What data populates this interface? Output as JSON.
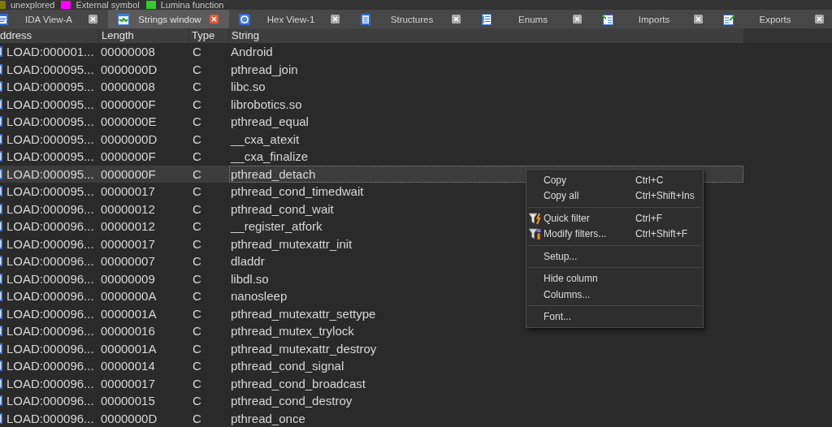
{
  "legend": [
    {
      "label": "unexplored",
      "color": "#807a00"
    },
    {
      "label": "External symbol",
      "color": "#ff00ff"
    },
    {
      "label": "Lumina function",
      "color": "#33cc33"
    }
  ],
  "tabs": [
    {
      "label": "IDA View-A",
      "kind": "ida-view",
      "selected": false
    },
    {
      "label": "Strings window",
      "kind": "strings",
      "selected": true
    },
    {
      "label": "Hex View-1",
      "kind": "hex",
      "selected": false
    },
    {
      "label": "Structures",
      "kind": "structures",
      "selected": false
    },
    {
      "label": "Enums",
      "kind": "enums",
      "selected": false
    },
    {
      "label": "Imports",
      "kind": "imports",
      "selected": false
    },
    {
      "label": "Exports",
      "kind": "exports",
      "selected": false
    }
  ],
  "table": {
    "columns": [
      "ddress",
      "Length",
      "Type",
      "String"
    ],
    "rows": [
      {
        "address": "LOAD:000001...",
        "length": "00000008",
        "type": "C",
        "string": "Android",
        "selected": false
      },
      {
        "address": "LOAD:000095...",
        "length": "0000000D",
        "type": "C",
        "string": "pthread_join",
        "selected": false
      },
      {
        "address": "LOAD:000095...",
        "length": "00000008",
        "type": "C",
        "string": "libc.so",
        "selected": false
      },
      {
        "address": "LOAD:000095...",
        "length": "0000000F",
        "type": "C",
        "string": "librobotics.so",
        "selected": false
      },
      {
        "address": "LOAD:000095...",
        "length": "0000000E",
        "type": "C",
        "string": "pthread_equal",
        "selected": false
      },
      {
        "address": "LOAD:000095...",
        "length": "0000000D",
        "type": "C",
        "string": "__cxa_atexit",
        "selected": false
      },
      {
        "address": "LOAD:000095...",
        "length": "0000000F",
        "type": "C",
        "string": "__cxa_finalize",
        "selected": false
      },
      {
        "address": "LOAD:000095...",
        "length": "0000000F",
        "type": "C",
        "string": "pthread_detach",
        "selected": true
      },
      {
        "address": "LOAD:000095...",
        "length": "00000017",
        "type": "C",
        "string": "pthread_cond_timedwait",
        "selected": false
      },
      {
        "address": "LOAD:000096...",
        "length": "00000012",
        "type": "C",
        "string": "pthread_cond_wait",
        "selected": false
      },
      {
        "address": "LOAD:000096...",
        "length": "00000012",
        "type": "C",
        "string": "__register_atfork",
        "selected": false
      },
      {
        "address": "LOAD:000096...",
        "length": "00000017",
        "type": "C",
        "string": "pthread_mutexattr_init",
        "selected": false
      },
      {
        "address": "LOAD:000096...",
        "length": "00000007",
        "type": "C",
        "string": "dladdr",
        "selected": false
      },
      {
        "address": "LOAD:000096...",
        "length": "00000009",
        "type": "C",
        "string": "libdl.so",
        "selected": false
      },
      {
        "address": "LOAD:000096...",
        "length": "0000000A",
        "type": "C",
        "string": "nanosleep",
        "selected": false
      },
      {
        "address": "LOAD:000096...",
        "length": "0000001A",
        "type": "C",
        "string": "pthread_mutexattr_settype",
        "selected": false
      },
      {
        "address": "LOAD:000096...",
        "length": "00000016",
        "type": "C",
        "string": "pthread_mutex_trylock",
        "selected": false
      },
      {
        "address": "LOAD:000096...",
        "length": "0000001A",
        "type": "C",
        "string": "pthread_mutexattr_destroy",
        "selected": false
      },
      {
        "address": "LOAD:000096...",
        "length": "00000014",
        "type": "C",
        "string": "pthread_cond_signal",
        "selected": false
      },
      {
        "address": "LOAD:000096...",
        "length": "00000017",
        "type": "C",
        "string": "pthread_cond_broadcast",
        "selected": false
      },
      {
        "address": "LOAD:000096...",
        "length": "00000015",
        "type": "C",
        "string": "pthread_cond_destroy",
        "selected": false
      },
      {
        "address": "LOAD:000096...",
        "length": "0000000D",
        "type": "C",
        "string": "pthread_once",
        "selected": false
      }
    ]
  },
  "context_menu": {
    "groups": [
      [
        {
          "label": "Copy",
          "shortcut": "Ctrl+C",
          "kind": "plain"
        },
        {
          "label": "Copy all",
          "shortcut": "Ctrl+Shift+Ins",
          "kind": "plain"
        }
      ],
      [
        {
          "label": "Quick filter",
          "shortcut": "Ctrl+F",
          "kind": "quick-filter"
        },
        {
          "label": "Modify filters...",
          "shortcut": "Ctrl+Shift+F",
          "kind": "modify-filters"
        }
      ],
      [
        {
          "label": "Setup...",
          "kind": "plain"
        }
      ],
      [
        {
          "label": "Hide column",
          "kind": "plain"
        },
        {
          "label": "Columns...",
          "kind": "plain"
        }
      ],
      [
        {
          "label": "Font...",
          "kind": "plain"
        }
      ]
    ]
  }
}
